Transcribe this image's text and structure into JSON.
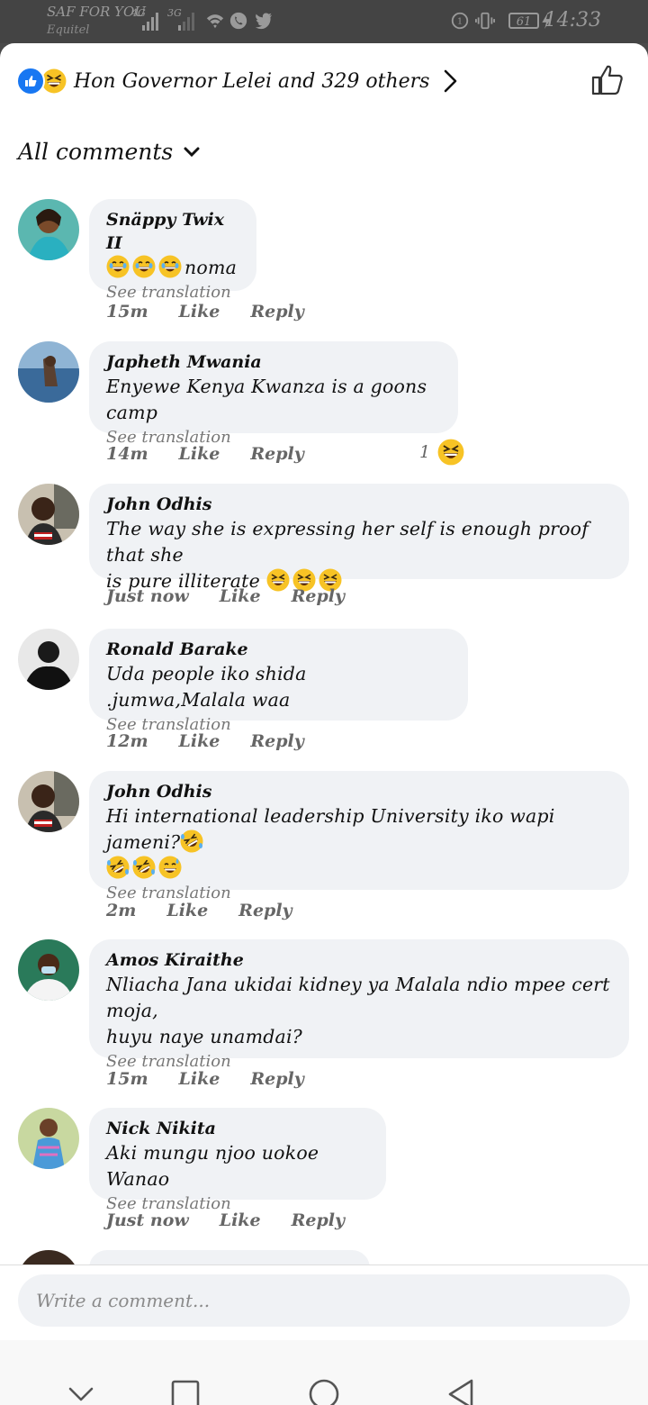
{
  "status": {
    "carrier": "SAF FOR YOU",
    "carrier2": "Equitel",
    "net1": "4G",
    "net2": "3G",
    "battery": "61",
    "time": "14:33"
  },
  "header": {
    "reactions_text": "Hon Governor Lelei and 329 others"
  },
  "filter": {
    "label": "All comments"
  },
  "comments": [
    {
      "author": "Snäppy Twix II",
      "text": "noma",
      "see_translation": "See translation",
      "time": "15m",
      "like": "Like",
      "reply": "Reply"
    },
    {
      "author": "Japheth Mwania",
      "text": "Enyewe Kenya Kwanza is a goons camp",
      "see_translation": "See translation",
      "time": "14m",
      "like": "Like",
      "reply": "Reply",
      "reaction_count": "1"
    },
    {
      "author": "John Odhis",
      "text1": "The way she is expressing her self is enough proof that she",
      "text2": "is pure illiterate",
      "time": "Just now",
      "like": "Like",
      "reply": "Reply"
    },
    {
      "author": "Ronald Barake",
      "text": "Uda people iko shida .jumwa,Malala waa",
      "see_translation": "See translation",
      "time": "12m",
      "like": "Like",
      "reply": "Reply"
    },
    {
      "author": "John Odhis",
      "text": "Hi international leadership University iko wapi jameni?",
      "see_translation": "See translation",
      "time": "2m",
      "like": "Like",
      "reply": "Reply"
    },
    {
      "author": "Amos Kiraithe",
      "text1": "Nliacha Jana ukidai kidney ya Malala ndio mpee cert moja,",
      "text2": "huyu naye unamdai?",
      "see_translation": "See translation",
      "time": "15m",
      "like": "Like",
      "reply": "Reply"
    },
    {
      "author": "Nick Nikita",
      "text": "Aki mungu njoo uokoe Wanao",
      "see_translation": "See translation",
      "time": "Just now",
      "like": "Like",
      "reply": "Reply"
    }
  ],
  "composer": {
    "placeholder": "Write a comment..."
  },
  "colors": {
    "brand_blue": "#1877f2",
    "bubble": "#f0f2f5",
    "emoji_yellow": "#f7c325"
  }
}
